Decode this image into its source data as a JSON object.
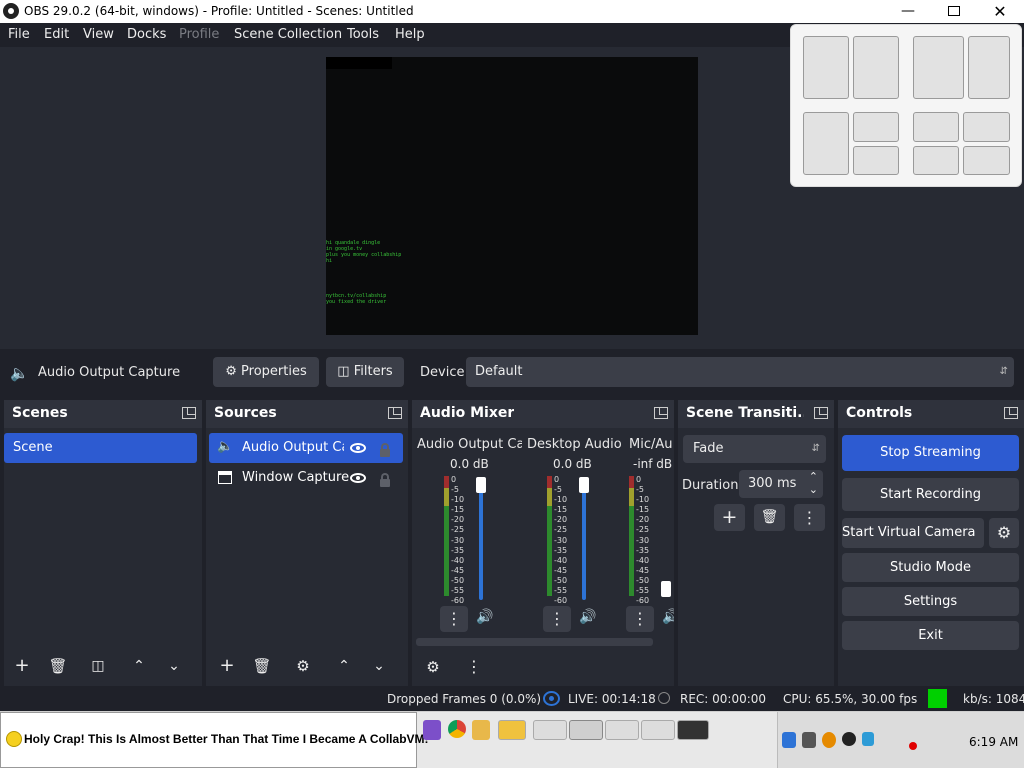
{
  "window": {
    "title": "OBS 29.0.2 (64-bit, windows) - Profile: Untitled - Scenes: Untitled"
  },
  "menu": [
    "File",
    "Edit",
    "View",
    "Docks",
    "Profile",
    "Scene Collection",
    "Tools",
    "Help"
  ],
  "preview_text": {
    "lines1": [
      "hi quandale dingle",
      "in google.tv",
      "plus you money collabship",
      "hi"
    ],
    "lines2": [
      "nytbcn.tv/collabship",
      "you fixed the driver"
    ]
  },
  "source_bar": {
    "source_name": "Audio Output Capture",
    "properties_label": "Properties",
    "filters_label": "Filters",
    "device_label": "Device",
    "device_value": "Default"
  },
  "scenes": {
    "title": "Scenes",
    "items": [
      "Scene"
    ]
  },
  "sources": {
    "title": "Sources",
    "items": [
      {
        "name": "Audio Output Ca"
      },
      {
        "name": "Window Capture"
      }
    ]
  },
  "mixer": {
    "title": "Audio Mixer",
    "channels": [
      {
        "name": "Audio Output Ca",
        "level": "0.0 dB"
      },
      {
        "name": "Desktop Audio",
        "level": "0.0 dB"
      },
      {
        "name": "Mic/Au",
        "level": "-inf dB"
      }
    ],
    "ticks": "0\n-5\n-10\n-15\n-20\n-25\n-30\n-35\n-40\n-45\n-50\n-55\n-60"
  },
  "transitions": {
    "title": "Scene Transiti...",
    "type": "Fade",
    "duration_label": "Duration",
    "duration_value": "300 ms"
  },
  "controls": {
    "title": "Controls",
    "stop_streaming": "Stop Streaming",
    "start_recording": "Start Recording",
    "start_virtual_camera": "Start Virtual Camera",
    "studio_mode": "Studio Mode",
    "settings": "Settings",
    "exit": "Exit"
  },
  "status": {
    "dropped": "Dropped Frames 0 (0.0%)",
    "live": "LIVE: 00:14:18",
    "rec": "REC: 00:00:00",
    "cpu": "CPU: 65.5%, 30.00 fps",
    "kbs": "kb/s: 1084"
  },
  "taskbar": {
    "banner": "Holy Crap! This Is Almost Better Than That Time I Became A CollabVM!",
    "clock": "6:19 AM"
  },
  "colors": {
    "accent": "#2d5bd1",
    "panel": "#272a33",
    "bg": "#1f2129",
    "live_indicator": "#00d000"
  }
}
